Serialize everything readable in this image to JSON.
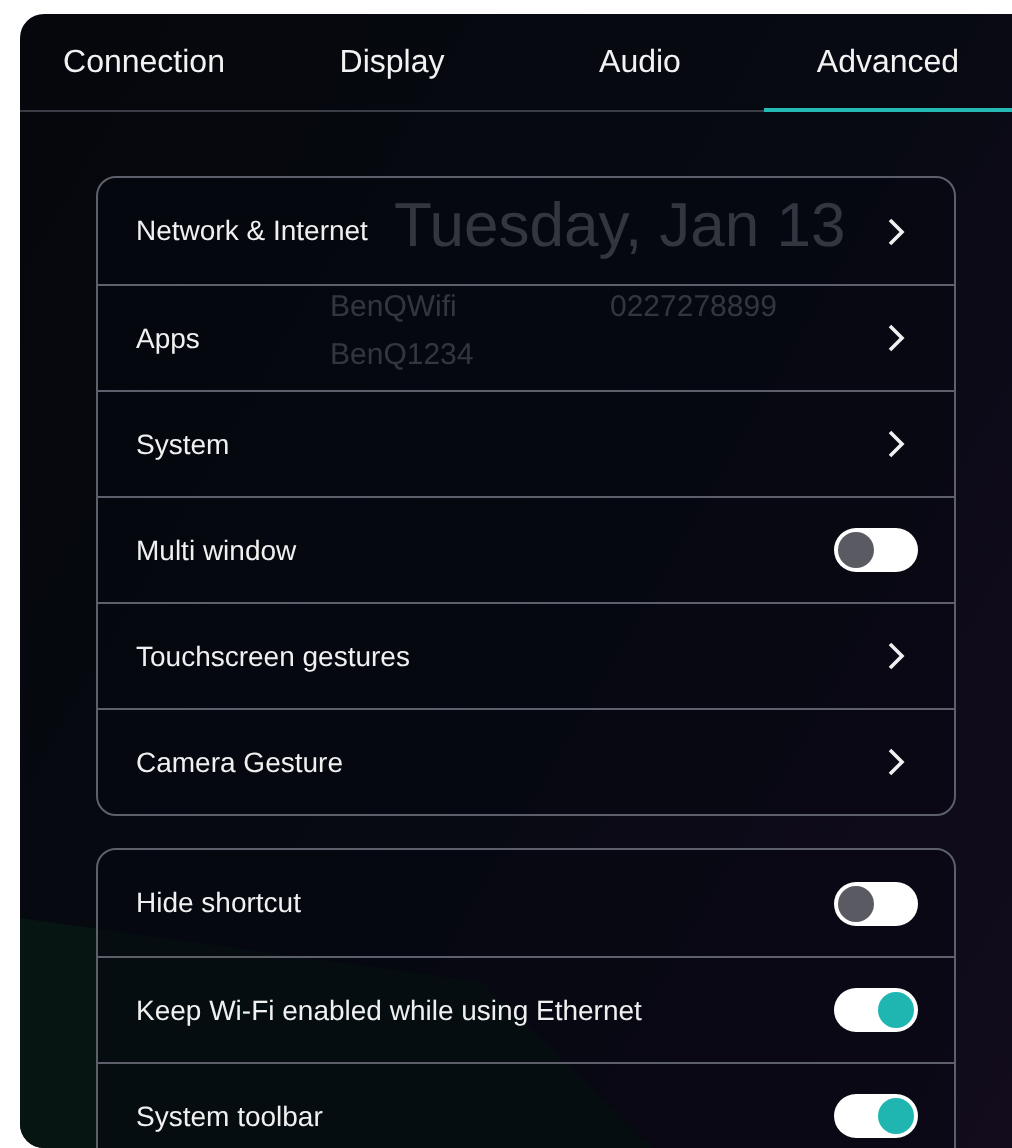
{
  "tabs": [
    {
      "label": "Connection",
      "selected": false
    },
    {
      "label": "Display",
      "selected": false
    },
    {
      "label": "Audio",
      "selected": false
    },
    {
      "label": "Advanced",
      "selected": true
    }
  ],
  "backdrop": {
    "date": "Tuesday, Jan 13",
    "wifi_name": "BenQWifi",
    "wifi_password": "BenQ1234",
    "phone": "0227278899"
  },
  "groups": [
    {
      "items": [
        {
          "label": "Network & Internet",
          "kind": "link"
        },
        {
          "label": "Apps",
          "kind": "link"
        },
        {
          "label": "System",
          "kind": "link"
        },
        {
          "label": "Multi window",
          "kind": "toggle",
          "on": false
        },
        {
          "label": "Touchscreen gestures",
          "kind": "link"
        },
        {
          "label": "Camera Gesture",
          "kind": "link"
        }
      ]
    },
    {
      "items": [
        {
          "label": "Hide shortcut",
          "kind": "toggle",
          "on": false
        },
        {
          "label": "Keep Wi-Fi enabled while using Ethernet",
          "kind": "toggle",
          "on": true
        },
        {
          "label": "System toolbar",
          "kind": "toggle",
          "on": true
        }
      ]
    }
  ]
}
